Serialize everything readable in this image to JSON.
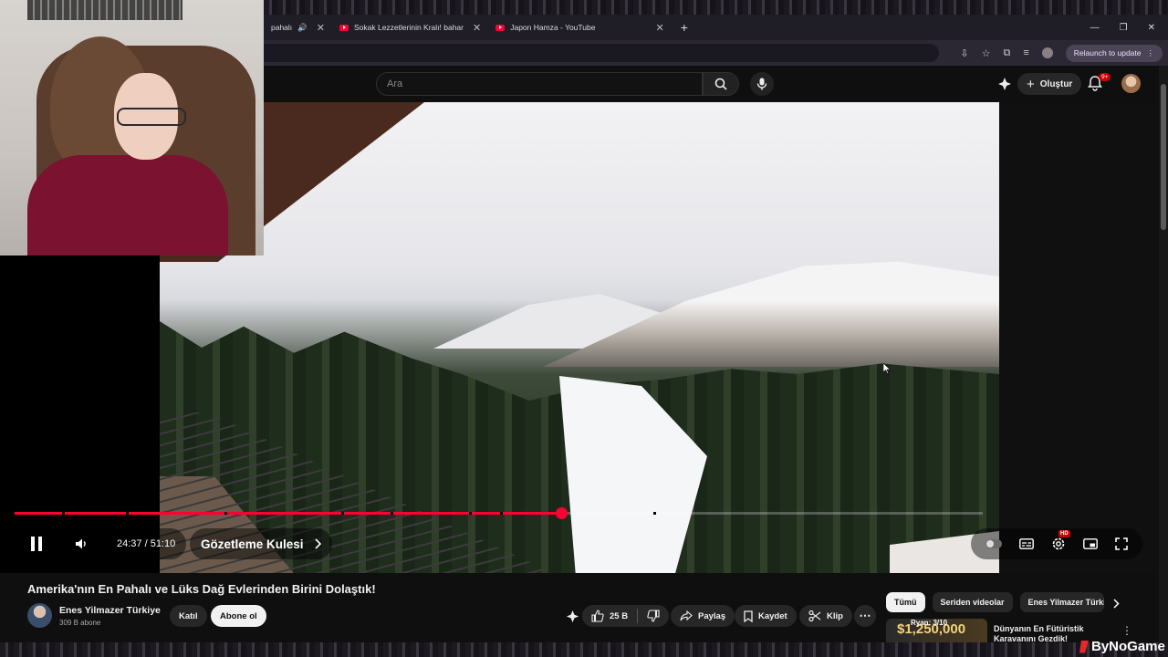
{
  "browser": {
    "tabs": [
      {
        "label": "pahalı",
        "has_audio": true
      },
      {
        "label": "Sokak Lezzetlerinin Kralı! bahar",
        "has_audio": false
      },
      {
        "label": "Japon Hamza - YouTube",
        "has_audio": false
      }
    ],
    "relaunch_label": "Relaunch to update"
  },
  "youtube_header": {
    "search_placeholder": "Ara",
    "create_label": "Oluştur",
    "notifications_badge": "9+"
  },
  "player": {
    "time_display": "24:37 / 51:10",
    "chapter_label": "Gözetleme Kulesi",
    "progress": 0.565,
    "hd_badge": "HD",
    "watermark": "EY",
    "accent_color": "#ff0033"
  },
  "video_info": {
    "title": "Amerika'nın En Pahalı ve Lüks Dağ Evlerinden Birini Dolaştık!",
    "channel_name": "Enes Yilmazer Türkiye",
    "subscribers": "309 B abone",
    "join_label": "Katıl",
    "subscribe_label": "Abone ol",
    "likes": "25 B",
    "share_label": "Paylaş",
    "save_label": "Kaydet",
    "clip_label": "Klip"
  },
  "sidebar": {
    "chips": [
      "Tümü",
      "Seriden videolar",
      "Enes Yilmazer Türkiye"
    ],
    "recommendation": {
      "thumb_text": "$1,250,000",
      "thumb_overlay": "Ryan: 3/10",
      "title": "Dünyanın En Fütüristik Karavanını Gezdik!"
    }
  },
  "stream_brand": "ByNoGame"
}
